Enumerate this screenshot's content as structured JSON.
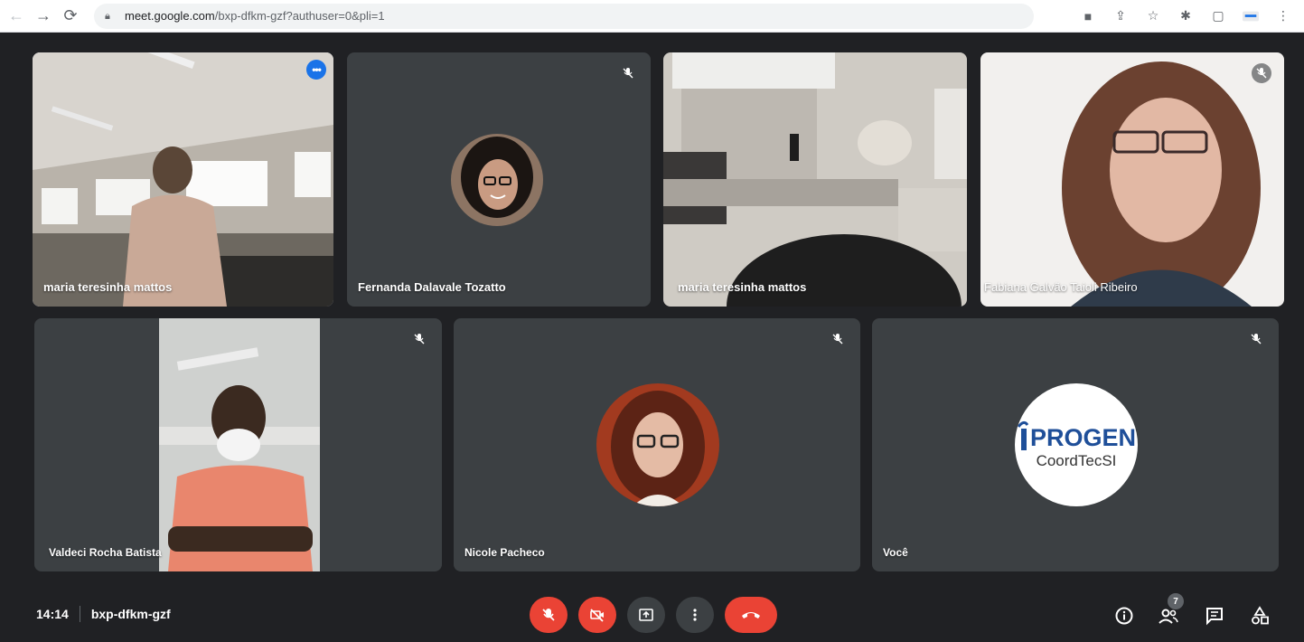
{
  "browser": {
    "url_host": "meet.google.com",
    "url_path": "/bxp-dfkm-gzf?authuser=0&pli=1"
  },
  "tiles": [
    {
      "name": "maria teresinha mattos"
    },
    {
      "name": "Fernanda Dalavale Tozatto"
    },
    {
      "name": "maria teresinha mattos"
    },
    {
      "name": "Fabiana Galvão Taioli Ribeiro"
    },
    {
      "name": "Valdeci Rocha Batista"
    },
    {
      "name": "Nicole Pacheco"
    },
    {
      "name": "Você"
    }
  ],
  "logo": {
    "brand": "PROGEN",
    "sub": "CoordTecSI"
  },
  "bottom": {
    "time": "14:14",
    "meeting_code": "bxp-dfkm-gzf",
    "participants_count": "7"
  },
  "colors": {
    "accent_blue": "#1a73e8",
    "highlight": "#8ab4f8",
    "danger_red": "#ea4335",
    "tile_bg": "#3c4043",
    "page_bg": "#202124"
  },
  "icons": {
    "back": "arrow-left-icon",
    "forward": "arrow-right-icon",
    "reload": "reload-icon",
    "lock": "lock-icon",
    "camera": "camera-icon",
    "share": "share-icon",
    "star": "star-icon",
    "extensions": "puzzle-icon",
    "sidepanel": "side-panel-icon",
    "profile": "profile-icon",
    "menu": "kebab-menu-icon",
    "mic_off": "mic-off-icon",
    "cam_off": "camera-off-icon",
    "present": "present-screen-icon",
    "more": "more-options-icon",
    "hangup": "hang-up-icon",
    "info": "info-icon",
    "people": "people-icon",
    "chat": "chat-icon",
    "activities": "activities-icon"
  }
}
